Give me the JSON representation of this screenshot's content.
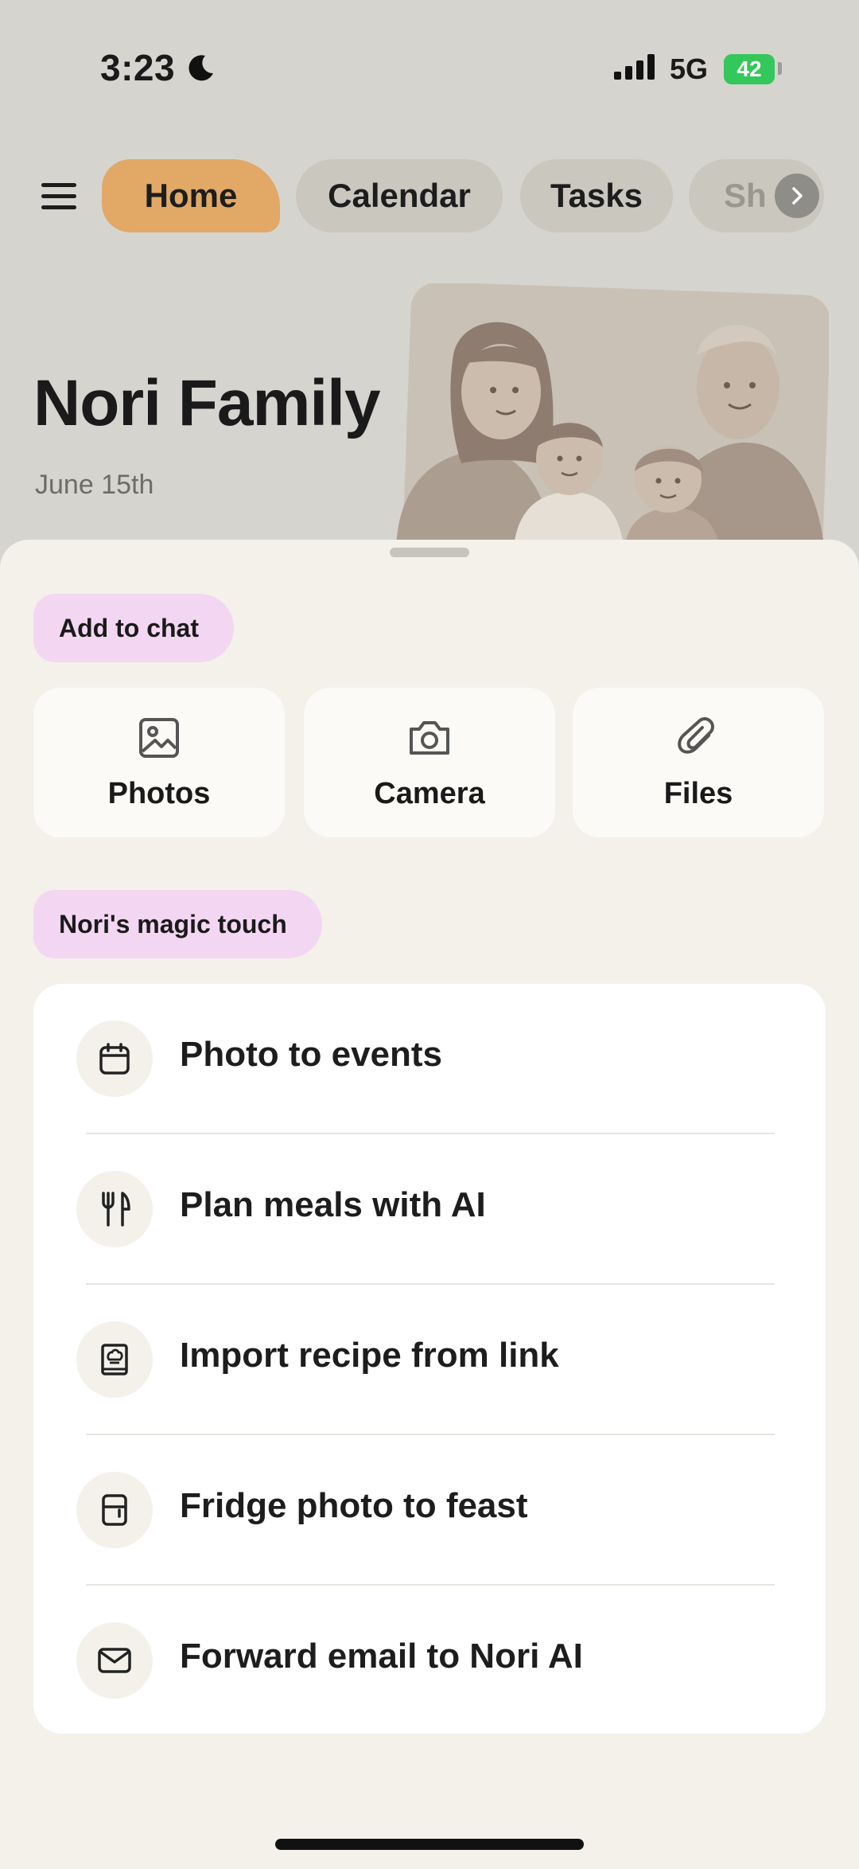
{
  "status_bar": {
    "time": "3:23",
    "network": "5G",
    "battery": "42"
  },
  "nav": {
    "tabs": [
      {
        "label": "Home"
      },
      {
        "label": "Calendar"
      },
      {
        "label": "Tasks"
      },
      {
        "label": "Sh"
      }
    ],
    "active_tab": "Home"
  },
  "header": {
    "title": "Nori Family",
    "date": "June 15th"
  },
  "sheet": {
    "add_section": {
      "title": "Add to chat",
      "options": [
        {
          "label": "Photos",
          "icon": "image-icon"
        },
        {
          "label": "Camera",
          "icon": "camera-icon"
        },
        {
          "label": "Files",
          "icon": "paperclip-icon"
        }
      ]
    },
    "magic_section": {
      "title": "Nori's magic touch",
      "items": [
        {
          "label": "Photo to events",
          "icon": "calendar-icon"
        },
        {
          "label": "Plan meals with AI",
          "icon": "utensils-icon"
        },
        {
          "label": "Import recipe from link",
          "icon": "recipe-book-icon"
        },
        {
          "label": "Fridge photo to feast",
          "icon": "fridge-icon"
        },
        {
          "label": "Forward email to Nori AI",
          "icon": "mail-icon"
        }
      ]
    }
  },
  "colors": {
    "accent": "#e2a865",
    "pill": "#f3d6f2",
    "background": "#d6d4cf",
    "sheet": "#f3f1ea"
  }
}
